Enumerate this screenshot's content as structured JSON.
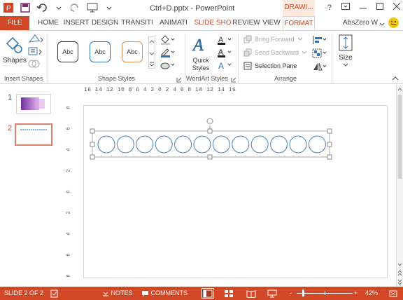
{
  "window": {
    "title": "Ctrl+D.pptx - PowerPoint",
    "context_tab": "DRAWI...",
    "controls": [
      "?",
      "restore",
      "minimize",
      "maximize",
      "close"
    ]
  },
  "tabs": [
    {
      "label": "FILE"
    },
    {
      "label": "HOME"
    },
    {
      "label": "INSERT"
    },
    {
      "label": "DESIGN"
    },
    {
      "label": "TRANSITI"
    },
    {
      "label": "ANIMATI"
    },
    {
      "label": "SLIDE SHO"
    },
    {
      "label": "REVIEW"
    },
    {
      "label": "VIEW"
    },
    {
      "label": "FORMAT"
    }
  ],
  "account": {
    "name": "AbsZero W"
  },
  "ribbon": {
    "insert_shapes": {
      "shapes_label": "Shapes",
      "group_label": "Insert Shapes"
    },
    "shape_styles": {
      "swatches": [
        "Abc",
        "Abc",
        "Abc"
      ],
      "group_label": "Shape Styles"
    },
    "wordart": {
      "quick_styles_label": "Quick Styles",
      "group_label": "WordArt Styles"
    },
    "arrange": {
      "bring_forward": "Bring Forward",
      "send_backward": "Send Backward",
      "selection_pane": "Selection Pane",
      "group_label": "Arrange"
    },
    "size": {
      "label": "Size"
    }
  },
  "thumbs": [
    {
      "number": "1"
    },
    {
      "number": "2"
    }
  ],
  "ruler_h": "16 14 12 10 8 6 4 2 0 2 4 6 8 10 12 14 16",
  "ruler_v": [
    "8",
    "6",
    "4",
    "2",
    "0",
    "2",
    "4",
    "6",
    "8"
  ],
  "slide": {
    "circle_count": 12,
    "circle_stroke": "#4f81bd"
  },
  "status": {
    "slide_indicator": "SLIDE 2 OF 2",
    "notes": "NOTES",
    "comments": "COMMENTS",
    "zoom": "42%",
    "minus": "-",
    "plus": "+"
  },
  "colors": {
    "accent": "#d24726",
    "status_bar": "#d24726"
  }
}
